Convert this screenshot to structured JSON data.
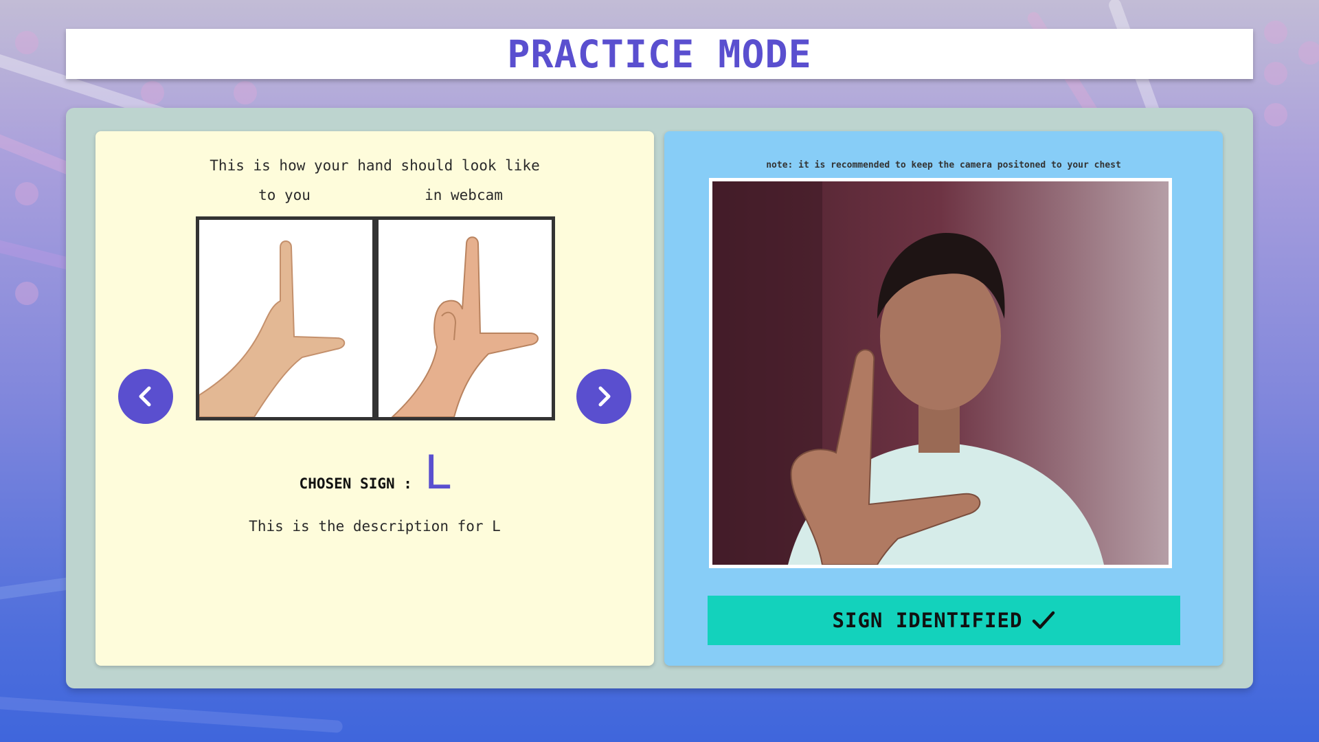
{
  "header": {
    "title": "PRACTICE MODE"
  },
  "left_panel": {
    "instruction": "This is how your hand should look like",
    "caption_you": "to you",
    "caption_webcam": "in webcam",
    "prev_icon": "chevron-left-icon",
    "next_icon": "chevron-right-icon",
    "chosen_label": "CHOSEN SIGN :",
    "chosen_letter": "L",
    "description": "This is the description for L"
  },
  "right_panel": {
    "note": "note: it is recommended to keep the camera positoned to your chest",
    "status_label": "SIGN IDENTIFIED",
    "status_icon": "checkmark-icon"
  },
  "colors": {
    "accent": "#5a4fcf",
    "left_panel_bg": "#fefcdb",
    "right_panel_bg": "#87cdf7",
    "status_bg": "#13d2bc",
    "card_bg": "#bdd4cf"
  }
}
